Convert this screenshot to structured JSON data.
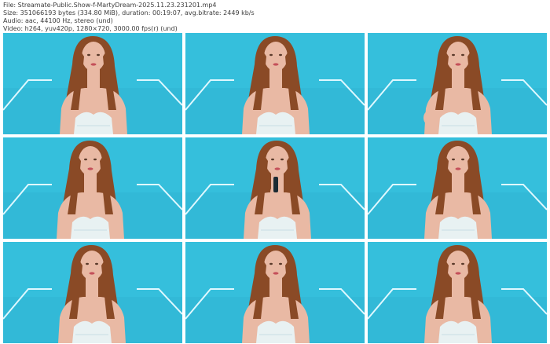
{
  "header": {
    "file_line": "File: Streamate-Public.Show-f-MartyDream-2025.11.23.231201.mp4",
    "size_line": "Size: 351066193 bytes (334.80 MiB), duration: 00:19:07, avg.bitrate: 2449 kb/s",
    "audio_line": "Audio: aac, 44100 Hz, stereo (und)",
    "video_line": "Video: h264, yuv420p, 1280×720, 3000.00 fps(r) (und)"
  },
  "thumbnails": [
    {
      "index": 1,
      "pose": "neutral"
    },
    {
      "index": 2,
      "pose": "neutral"
    },
    {
      "index": 3,
      "pose": "hand-low"
    },
    {
      "index": 4,
      "pose": "neutral"
    },
    {
      "index": 5,
      "pose": "holding-object"
    },
    {
      "index": 6,
      "pose": "neutral"
    },
    {
      "index": 7,
      "pose": "neutral"
    },
    {
      "index": 8,
      "pose": "neutral"
    },
    {
      "index": 9,
      "pose": "neutral"
    }
  ],
  "colors": {
    "background": "#35bfdc",
    "neon": "#dff8ff",
    "hair": "#8a4a26",
    "skin": "#e9b9a4",
    "top": "#e8f3f7"
  }
}
